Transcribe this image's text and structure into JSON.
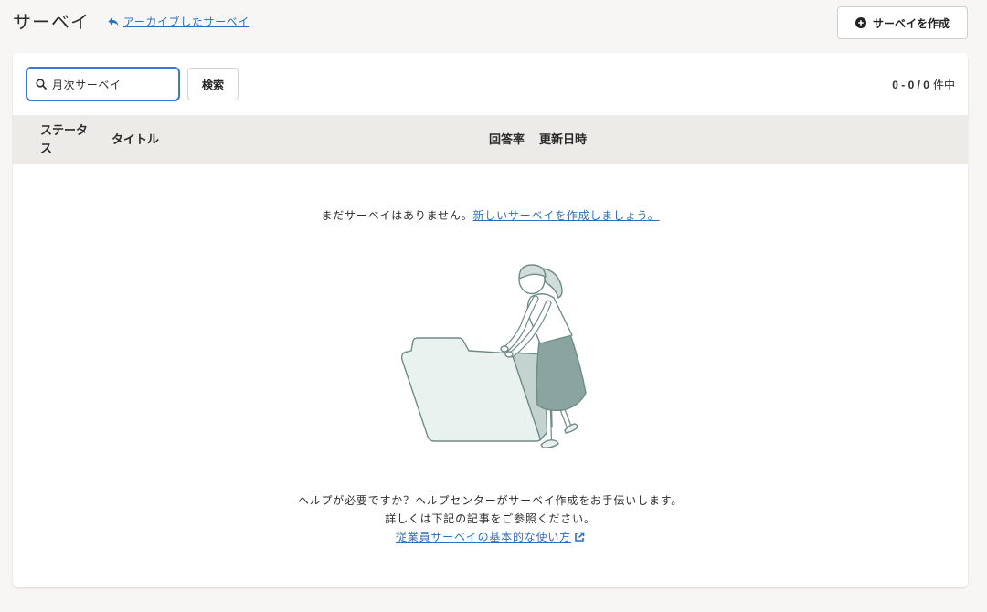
{
  "header": {
    "title": "サーベイ",
    "archive_link_label": "アーカイブしたサーベイ",
    "archive_link_icon": "reply-arrow-icon",
    "create_button_label": "サーベイを作成",
    "create_button_icon": "plus-circle-icon"
  },
  "toolbar": {
    "search_icon": "search-icon",
    "search_value": "月次サーベイ",
    "search_button_label": "検索",
    "count_range": "0 - 0 / 0",
    "count_suffix": "件中"
  },
  "table": {
    "columns": [
      "ステータス",
      "タイトル",
      "回答率",
      "更新日時"
    ]
  },
  "empty_state": {
    "message": "まだサーベイはありません。",
    "create_link": "新しいサーベイを作成しましょう。",
    "help_lines": [
      "ヘルプが必要ですか？ヘルプセンターがサーベイ作成をお手伝いします。",
      "詳しくは下記の記事をご参照ください。"
    ],
    "help_link": "従業員サーベイの基本的な使い方",
    "help_link_icon": "external-link-icon"
  },
  "colors": {
    "page_bg": "#f7f6f4",
    "link": "#2b6fc0",
    "focus_ring": "#3a78d4",
    "header_band": "#ecebe7",
    "text": "#2e2e2e"
  }
}
